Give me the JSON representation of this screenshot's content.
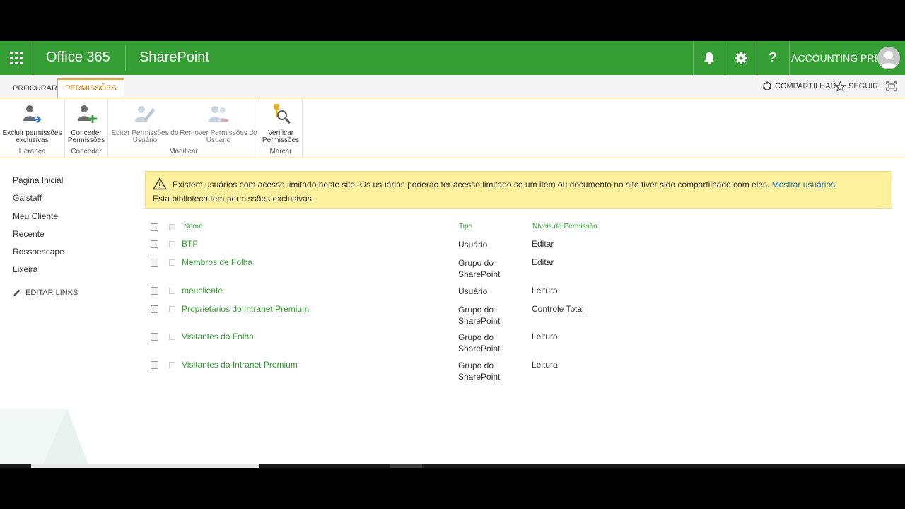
{
  "suitebar": {
    "brand": "Office 365",
    "app": "SharePoint",
    "user": "ACCOUNTING PRE...",
    "icons": [
      "waffle-icon",
      "bell-icon",
      "gear-icon",
      "help-icon",
      "avatar-icon"
    ]
  },
  "tabs": {
    "browse": "PROCURAR",
    "permissions": "PERMISSÕES",
    "share": "COMPARTILHAR",
    "follow": "SEGUIR"
  },
  "ribbon": {
    "groups": {
      "inheritance": "Herança",
      "grant": "Conceder",
      "modify": "Modificar",
      "check": "Marcar"
    },
    "buttons": {
      "delete_unique_l1": "Excluir permissões",
      "delete_unique_l2": "exclusivas",
      "grant_l1": "Conceder",
      "grant_l2": "Permissões",
      "edit_l1": "Editar Permissões do",
      "edit_l2": "Usuário",
      "remove_l1": "Remover Permissões do",
      "remove_l2": "Usuário",
      "check_l1": "Verificar",
      "check_l2": "Permissões"
    }
  },
  "leftnav": {
    "items": [
      "Página Inicial",
      "Galstaff",
      "Meu Cliente",
      "Recente",
      "Rossoescape",
      "Lixeira"
    ],
    "edit_links": "EDITAR LINKS"
  },
  "warning": {
    "text": "Existem usuários com acesso limitado neste site. Os usuários poderão ter acesso limitado se um item ou documento no site tiver sido compartilhado com eles.",
    "link": "Mostrar usuários.",
    "text2": "Esta biblioteca tem permissões exclusivas."
  },
  "table": {
    "headers": {
      "name": "Nome",
      "type": "Tipo",
      "perm": "Níveis de Permissão"
    },
    "rows": [
      {
        "name": "BTF",
        "type1": "Usuário",
        "type2": "",
        "perm": "Editar"
      },
      {
        "name": "Membros de Folha",
        "type1": "Grupo do",
        "type2": "SharePoint",
        "perm": "Editar"
      },
      {
        "name": "meucliente",
        "type1": "Usuário",
        "type2": "",
        "perm": "Leitura"
      },
      {
        "name": "Proprietários do Intranet Premium",
        "type1": "Grupo do",
        "type2": "SharePoint",
        "perm": "Controle Total"
      },
      {
        "name": "Visitantes da Folha",
        "type1": "Grupo do",
        "type2": "SharePoint",
        "perm": "Leitura"
      },
      {
        "name": "Visitantes da Intranet Premium",
        "type1": "Grupo do",
        "type2": "SharePoint",
        "perm": "Leitura"
      }
    ]
  },
  "colors": {
    "brand": "#349e34",
    "accent": "#f5a623",
    "warning_bg": "#fff19d",
    "link": "#1e6fb8"
  }
}
